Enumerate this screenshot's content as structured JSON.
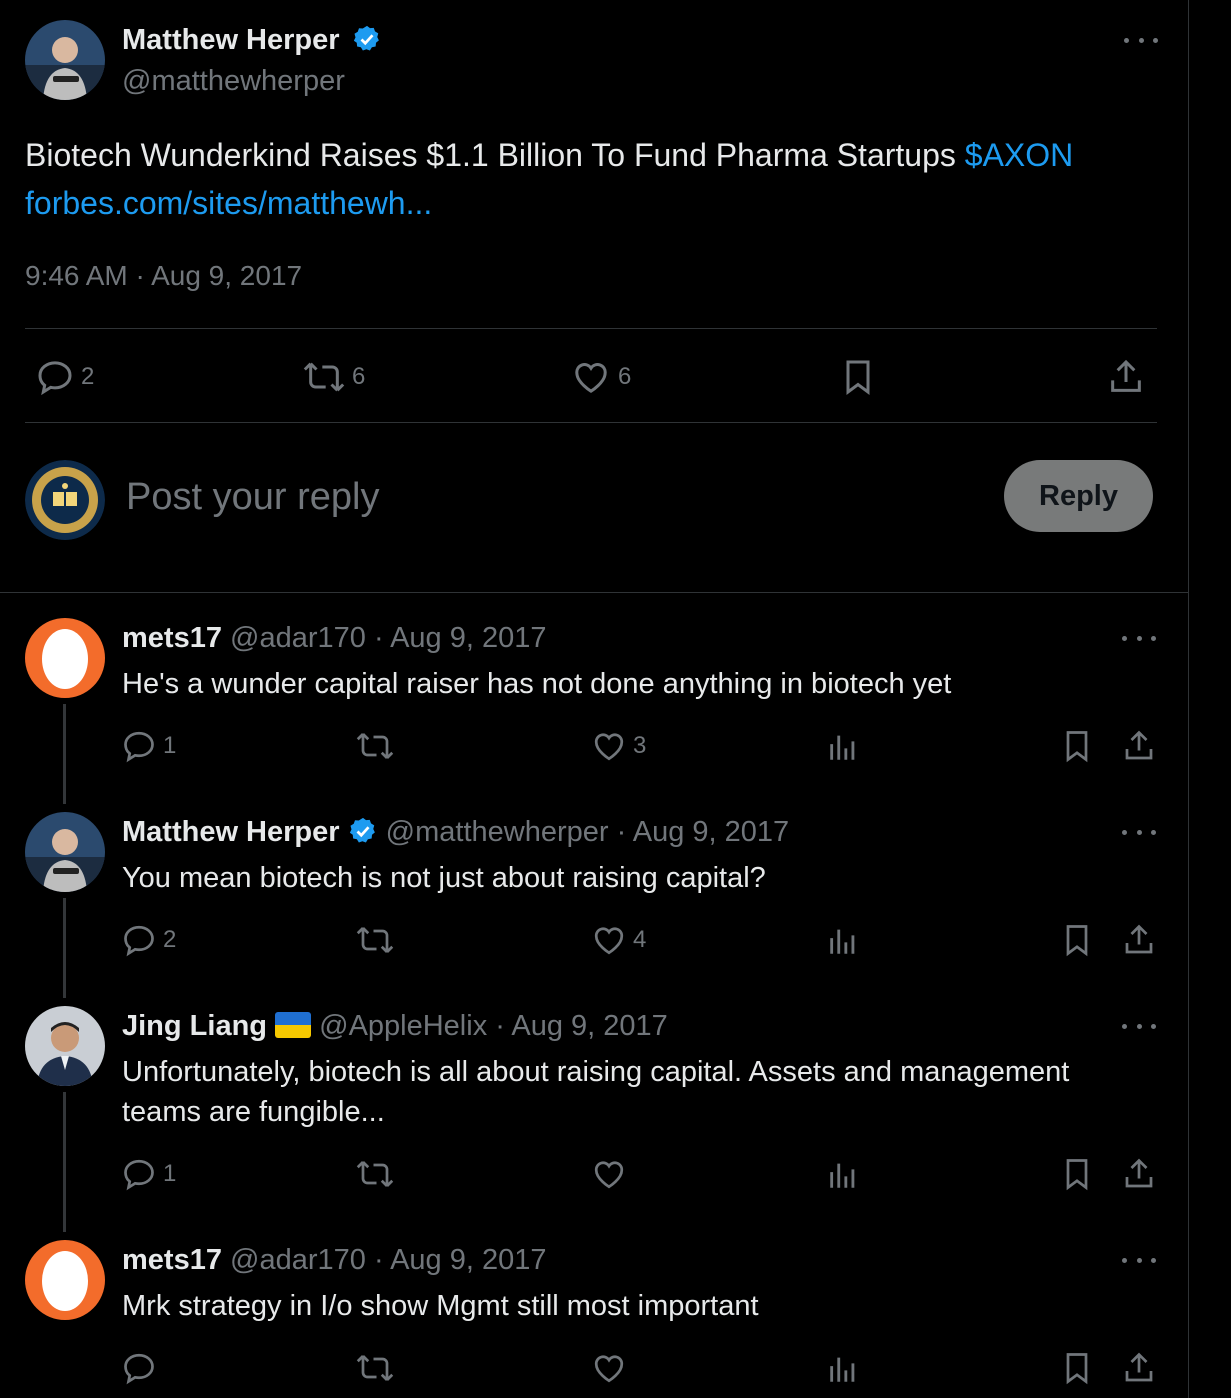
{
  "main_tweet": {
    "author_name": "Matthew Herper",
    "author_handle": "@matthewherper",
    "text": "Biotech Wunderkind Raises $1.1 Billion To Fund Pharma Startups",
    "cashtag": "$AXON",
    "link": "forbes.com/sites/matthewh...",
    "timestamp": "9:46 AM · Aug 9, 2017",
    "replies": "2",
    "retweets": "6",
    "likes": "6"
  },
  "composer": {
    "placeholder": "Post your reply",
    "button_label": "Reply"
  },
  "replies": [
    {
      "name": "mets17",
      "handle": "@adar170",
      "date": "· Aug 9, 2017",
      "text_lines": [
        "He's a wunder capital raiser has not done anything in biotech yet"
      ],
      "replies": "1",
      "retweets": "",
      "likes": "3"
    },
    {
      "name": "Matthew Herper",
      "handle": "@matthewherper",
      "date": "· Aug 9, 2017",
      "text_lines": [
        "You mean biotech is not just about raising capital?"
      ],
      "replies": "2",
      "retweets": "",
      "likes": "4"
    },
    {
      "name": "Jing Liang",
      "handle": "@AppleHelix",
      "date": "· Aug 9, 2017",
      "text_lines": [
        "Unfortunately, biotech is all about raising capital. Assets and management",
        "teams are fungible..."
      ],
      "replies": "1",
      "retweets": "",
      "likes": ""
    },
    {
      "name": "mets17",
      "handle": "@adar170",
      "date": "· Aug 9, 2017",
      "text_lines": [
        "Mrk strategy in I/o show Mgmt still most important"
      ],
      "replies": "",
      "retweets": "",
      "likes": ""
    }
  ],
  "colors": {
    "background": "#000000",
    "text": "#e7e9ea",
    "muted": "#71767b",
    "link": "#1d9bf0",
    "verified": "#1d9bf0",
    "reply_button_bg": "#787a7a"
  }
}
